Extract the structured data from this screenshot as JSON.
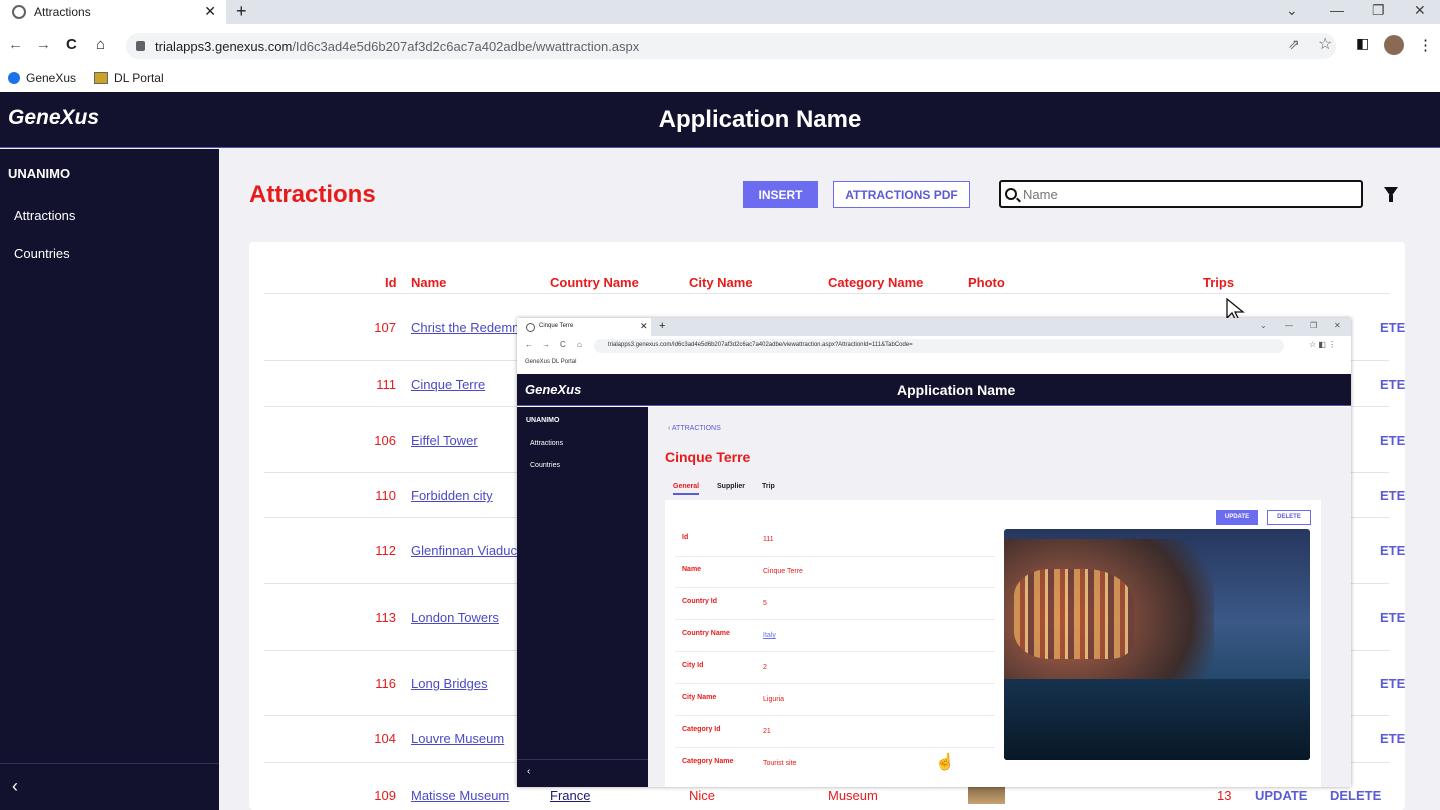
{
  "browser": {
    "tab_title": "Attractions",
    "url_host": "trialapps3.genexus.com",
    "url_path": "/Id6c3ad4e5d6b207af3d2c6ac7a402adbe/wwattraction.aspx",
    "bookmarks": [
      "GeneXus",
      "DL Portal"
    ]
  },
  "app": {
    "logo": "GeneXus",
    "title": "Application Name"
  },
  "sidebar": {
    "group": "UNANIMO",
    "items": [
      "Attractions",
      "Countries"
    ],
    "collapse": "‹"
  },
  "page": {
    "title": "Attractions",
    "insert_label": "INSERT",
    "pdf_label": "ATTRACTIONS PDF",
    "search_placeholder": "Name"
  },
  "table": {
    "headers": {
      "id": "Id",
      "name": "Name",
      "country": "Country Name",
      "city": "City Name",
      "category": "Category Name",
      "photo": "Photo",
      "trips": "Trips"
    },
    "rows": [
      {
        "id": "107",
        "name": "Christ the Redemm",
        "del": "ETE"
      },
      {
        "id": "111",
        "name": "Cinque Terre",
        "del": "ETE"
      },
      {
        "id": "106",
        "name": "Eiffel Tower",
        "del": "ETE"
      },
      {
        "id": "110",
        "name": "Forbidden city",
        "del": "ETE"
      },
      {
        "id": "112",
        "name": "Glenfinnan Viaduct",
        "del": "ETE"
      },
      {
        "id": "113",
        "name": "London Towers",
        "del": "ETE"
      },
      {
        "id": "116",
        "name": "Long Bridges",
        "del": "ETE"
      },
      {
        "id": "104",
        "name": "Louvre Museum",
        "del": "ETE"
      },
      {
        "id": "109",
        "name": "Matisse Museum",
        "country": "France",
        "city": "Nice",
        "category": "Museum",
        "trips": "13",
        "update": "UPDATE",
        "delete": "DELETE"
      }
    ]
  },
  "overlay": {
    "tab_title": "Cinque Terre",
    "url": "trialapps3.genexus.com/Id6c3ad4e5d6b207af3d2c6ac7a402adbe/viewattraction.aspx?AttractionId=111&TabCode=",
    "bookmarks": "GeneXus   DL Portal",
    "logo": "GeneXus",
    "title": "Application Name",
    "side_group": "UNANIMO",
    "side_items": [
      "Attractions",
      "Countries"
    ],
    "back": "‹  ATTRACTIONS",
    "detail_title": "Cinque Terre",
    "tabs": [
      "General",
      "Supplier",
      "Trip"
    ],
    "update": "UPDATE",
    "delete": "DELETE",
    "fields": [
      {
        "label": "Id",
        "value": "111"
      },
      {
        "label": "Name",
        "value": "Cinque Terre"
      },
      {
        "label": "Country Id",
        "value": "5"
      },
      {
        "label": "Country Name",
        "value": "Italy"
      },
      {
        "label": "City Id",
        "value": "2"
      },
      {
        "label": "City Name",
        "value": "Liguria"
      },
      {
        "label": "Category Id",
        "value": "21"
      },
      {
        "label": "Category Name",
        "value": "Tourist site"
      }
    ]
  }
}
